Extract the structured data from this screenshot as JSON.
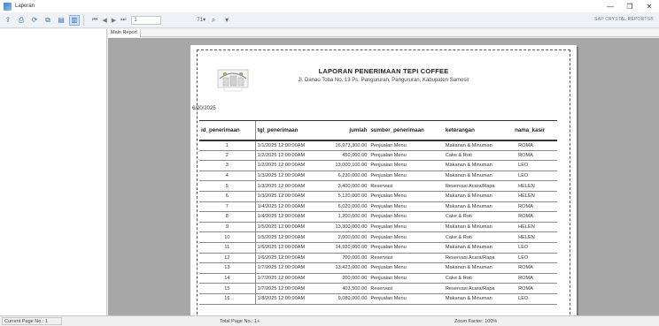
{
  "window": {
    "title": "Laporan",
    "controls": {
      "minimize": "—",
      "maximize": "❐",
      "close": "✕"
    }
  },
  "toolbar": {
    "page_value": "1",
    "zoom_label": "71▾",
    "brand": "SAP CRYSTAL REPORTS®"
  },
  "tabs": [
    {
      "label": "Main Report"
    }
  ],
  "report": {
    "title": "LAPORAN PENERIMAAN TEPI COFFEE",
    "address": "Jl. Danau Toba No. 13 Ps. Pangururan, Pangururan, Kabupaten Samosir",
    "date": "6/20/2025",
    "columns": [
      "id_penerimaan",
      "tgl_penerimaan",
      "jumlah",
      "sumber_penerimaan",
      "keterangan",
      "nama_kasir"
    ],
    "rows": [
      [
        "1",
        "1/1/2025  12:00:00AM",
        "16,973,300.00",
        "Penjualan Menu",
        "Makanan & Minuman",
        "ROMA"
      ],
      [
        "2",
        "1/2/2025  12:00:00AM",
        "450,000.00",
        "Penjualan Menu",
        "Cake & Roti",
        "ROMA"
      ],
      [
        "3",
        "1/2/2025  12:00:00AM",
        "13,000,100.00",
        "Penjualan Menu",
        "Makanan & Minuman",
        "LEO"
      ],
      [
        "4",
        "1/3/2025  12:00:00AM",
        "6,230,000.00",
        "Penjualan Menu",
        "Makanan & Minuman",
        "LEO"
      ],
      [
        "5",
        "1/3/2025  12:00:00AM",
        "3,400,000.00",
        "Reservasi",
        "Reservasi Acara/Rapa",
        "HELEN"
      ],
      [
        "6",
        "1/3/2025  12:00:00AM",
        "5,120,000.00",
        "Penjualan Menu",
        "Makanan & Minuman",
        "HELEN"
      ],
      [
        "7",
        "1/4/2025  12:00:00AM",
        "6,020,000.00",
        "Penjualan Menu",
        "Makanan & Minuman",
        "ROMA"
      ],
      [
        "8",
        "1/4/2025  12:00:00AM",
        "1,200,000.00",
        "Penjualan Menu",
        "Cake & Roti",
        "ROMA"
      ],
      [
        "9",
        "1/5/2025  12:00:00AM",
        "13,300,000.00",
        "Penjualan Menu",
        "Makanan & Minuman",
        "HELEN"
      ],
      [
        "10",
        "1/5/2025  12:00:00AM",
        "2,000,000.00",
        "Penjualan Menu",
        "Cake & Roti",
        "HELEN"
      ],
      [
        "11",
        "1/6/2025  12:00:00AM",
        "14,920,000.00",
        "Penjualan Menu",
        "Makanan & Minuman",
        "LEO"
      ],
      [
        "12",
        "1/6/2025  12:00:00AM",
        "700,000.00",
        "Reservasi",
        "Reservasi Acara/Rapa",
        "LEO"
      ],
      [
        "13",
        "1/7/2025  12:00:00AM",
        "13,423,000.00",
        "Penjualan Menu",
        "Makanan & Minuman",
        "ROMA"
      ],
      [
        "14",
        "1/7/2025  12:00:00AM",
        "200,000.00",
        "Penjualan Menu",
        "Cake & Roti",
        "ROMA"
      ],
      [
        "15",
        "1/7/2025  12:00:00AM",
        "403,500.00",
        "Reservasi",
        "Reservasi Acara/Rapa",
        "ROMA"
      ],
      [
        "16",
        "1/8/2025  12:00:00AM",
        "9,080,000.00",
        "Penjualan Menu",
        "Makanan & Minuman",
        "LEO"
      ]
    ]
  },
  "status": {
    "current_page": "Current Page No.: 1",
    "total_page": "Total Page No.: 1+",
    "zoom": "Zoom Factor: 100%"
  }
}
